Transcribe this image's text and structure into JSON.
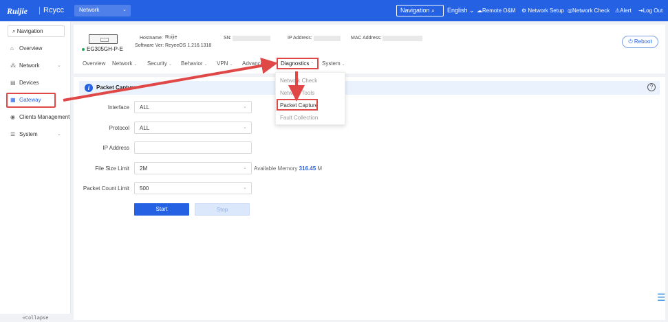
{
  "topbar": {
    "logo_ruijie": "Ruijie",
    "logo_reyee": "Rcycc",
    "network_select": "Network",
    "navigation_btn": "Navigation",
    "language": "English",
    "remote_om": "Remote O&M",
    "network_setup": "Network Setup",
    "network_check": "Network Check",
    "alert": "Alert",
    "logout": "Log Out"
  },
  "sidebar": {
    "search": "Navigation",
    "items": [
      {
        "label": "Overview",
        "icon": "home-icon"
      },
      {
        "label": "Network",
        "icon": "network-icon"
      },
      {
        "label": "Devices",
        "icon": "devices-icon"
      },
      {
        "label": "Gateway",
        "icon": "gateway-icon"
      },
      {
        "label": "Clients Management",
        "icon": "clients-icon"
      },
      {
        "label": "System",
        "icon": "system-icon"
      }
    ],
    "collapse": "«Collapse"
  },
  "device": {
    "model": "EG305GH-P-E",
    "hostname_label": "Hostname:",
    "hostname": "Ruijie",
    "software_label": "Software Ver:",
    "software": "ReyeeOS 1.216.1318",
    "sn_label": "SN:",
    "ip_label": "IP Address:",
    "mac_label": "MAC Address:",
    "reboot": "Reboot"
  },
  "tabs": [
    "Overview",
    "Network",
    "Security",
    "Behavior",
    "VPN",
    "Advanced",
    "Diagnostics",
    "System"
  ],
  "dropdown": [
    "Network Check",
    "Network Tools",
    "Packet Capture",
    "Fault Collection"
  ],
  "packet_capture": {
    "title": "Packet Capture",
    "interface_label": "Interface",
    "interface_value": "ALL",
    "protocol_label": "Protocol",
    "protocol_value": "ALL",
    "ip_label": "IP Address",
    "ip_value": "",
    "filesize_label": "File Size Limit",
    "filesize_value": "2M",
    "available_label": "Available Memory",
    "available_value": "316.45",
    "available_unit": "M",
    "count_label": "Packet Count Limit",
    "count_value": "500",
    "start": "Start",
    "stop": "Stop"
  },
  "colors": {
    "brand": "#2461e3",
    "highlight": "#e04848"
  }
}
